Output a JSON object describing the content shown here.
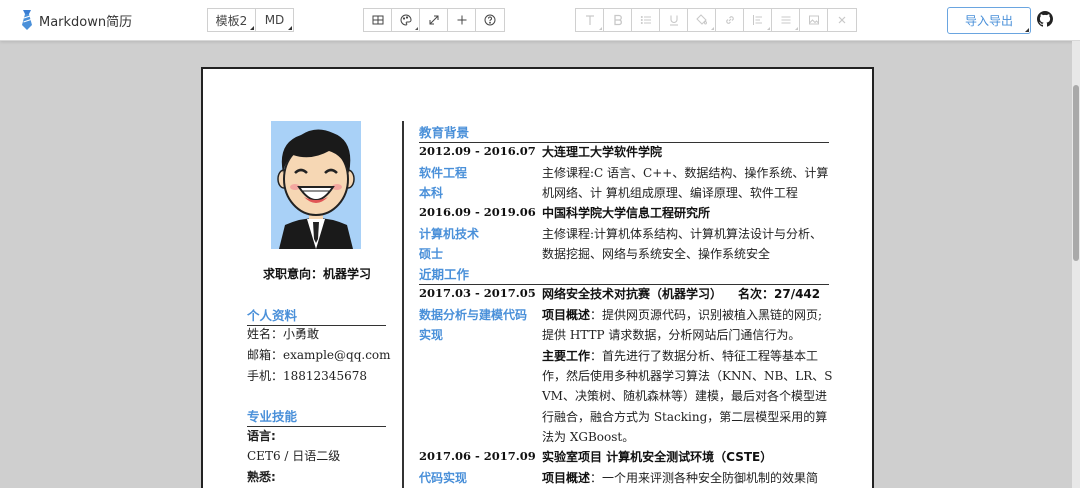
{
  "app": {
    "title": "Markdown简历"
  },
  "toolbar": {
    "template_label": "模板2",
    "md_label": "MD",
    "export_label": "导入导出"
  },
  "icons": {
    "view_group": [
      "table-icon",
      "palette-icon",
      "expand-icon",
      "plus-icon",
      "help-icon"
    ],
    "format_group": [
      "text-size-icon",
      "bold-icon",
      "list-icon",
      "underline-icon",
      "fill-color-icon",
      "link-icon",
      "align-icon",
      "justify-icon",
      "image-icon",
      "close-icon"
    ]
  },
  "resume": {
    "intent": "求职意向：机器学习",
    "personal": {
      "heading": "个人资料",
      "name": "姓名：小勇敢",
      "email": "邮箱：example@qq.com",
      "phone": "手机：18812345678"
    },
    "skills": {
      "heading": "专业技能",
      "lang_label": "语言:",
      "lang_value": "CET6 / 日语二级",
      "familiar_label": "熟悉:"
    },
    "education": {
      "heading": "教育背景",
      "items": [
        {
          "date": "2012.09 - 2016.07",
          "school": "大连理工大学软件学院",
          "major": "软件工程",
          "degree": "本科",
          "course_line1": "主修课程:C 语言、C++、数据结构、操作系统、计算",
          "course_line2": "机网络、计 算机组成原理、编译原理、软件工程"
        },
        {
          "date": "2016.09 - 2019.06",
          "school": "中国科学院大学信息工程研究所",
          "major": "计算机技术",
          "degree": "硕士",
          "course_line1": "主修课程:计算机体系结构、计算机算法设计与分析、",
          "course_line2": "数据挖掘、网络与系统安全、操作系统安全"
        }
      ]
    },
    "work": {
      "heading": "近期工作",
      "items": [
        {
          "date": "2017.03 - 2017.05",
          "title": "网络安全技术对抗赛（机器学习）",
          "rank": "名次：27/442",
          "role_line1": "数据分析与建模代码",
          "role_line2": "实现",
          "overview_label": "项目概述",
          "overview_line1": "：提供网页源代码，识别被植入黑链的网页;",
          "overview_line2": "提供 HTTP 请求数据，分析网站后门通信行为。",
          "work_label": "主要工作",
          "work_line1": "：首先进行了数据分析、特征工程等基本工",
          "work_line2": "作，然后使用多种机器学习算法（KNN、NB、LR、S",
          "work_line3": "VM、决策树、随机森林等）建模，最后对各个模型进",
          "work_line4": "行融合，融合方式为 Stacking，第二层模型采用的算",
          "work_line5": "法为 XGBoost。"
        },
        {
          "date": "2017.06 - 2017.09",
          "title": "实验室项目 计算机安全测试环境（CSTE）",
          "role_line1": "代码实现",
          "overview_label": "项目概述",
          "overview_line1": "：一个用来评测各种安全防御机制的效果简"
        }
      ]
    }
  }
}
